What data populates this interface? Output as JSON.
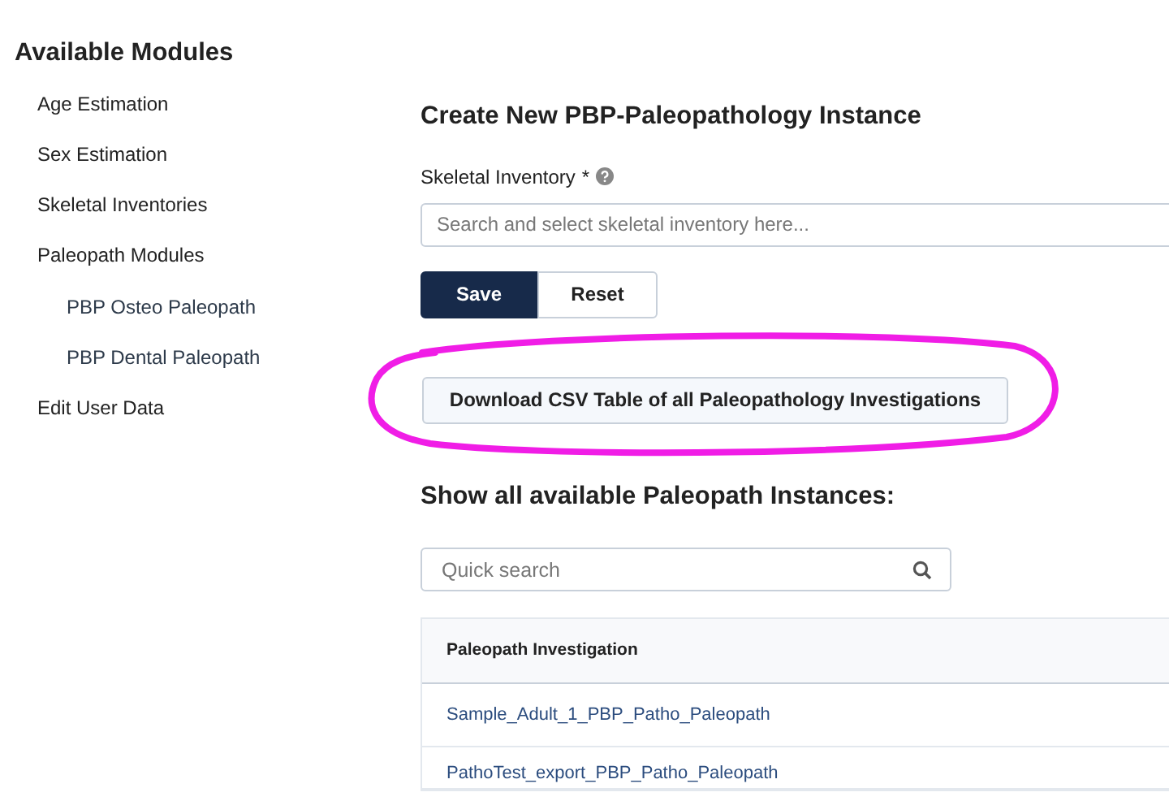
{
  "sidebar": {
    "title": "Available Modules",
    "items": [
      {
        "label": "Age Estimation"
      },
      {
        "label": "Sex Estimation"
      },
      {
        "label": "Skeletal Inventories"
      },
      {
        "label": "Paleopath Modules",
        "children": [
          {
            "label": "PBP Osteo Paleopath"
          },
          {
            "label": "PBP Dental Paleopath"
          }
        ]
      },
      {
        "label": "Edit User Data"
      }
    ]
  },
  "form": {
    "title": "Create New PBP-Paleopathology Instance",
    "field_label": "Skeletal Inventory",
    "required_mark": "*",
    "placeholder": "Search and select skeletal inventory here...",
    "buttons": [
      {
        "label": "Save",
        "kind": "primary"
      },
      {
        "label": "Reset",
        "kind": "secondary"
      }
    ]
  },
  "download_button": "Download CSV Table of all Paleopathology Investigations",
  "instances": {
    "title": "Show all available Paleopath Instances:",
    "search": {
      "placeholder": "Quick search"
    },
    "columns": [
      "Paleopath Investigation"
    ],
    "rows": [
      [
        "Sample_Adult_1_PBP_Patho_Paleopath"
      ],
      [
        "PathoTest_export_PBP_Patho_Paleopath"
      ]
    ]
  }
}
